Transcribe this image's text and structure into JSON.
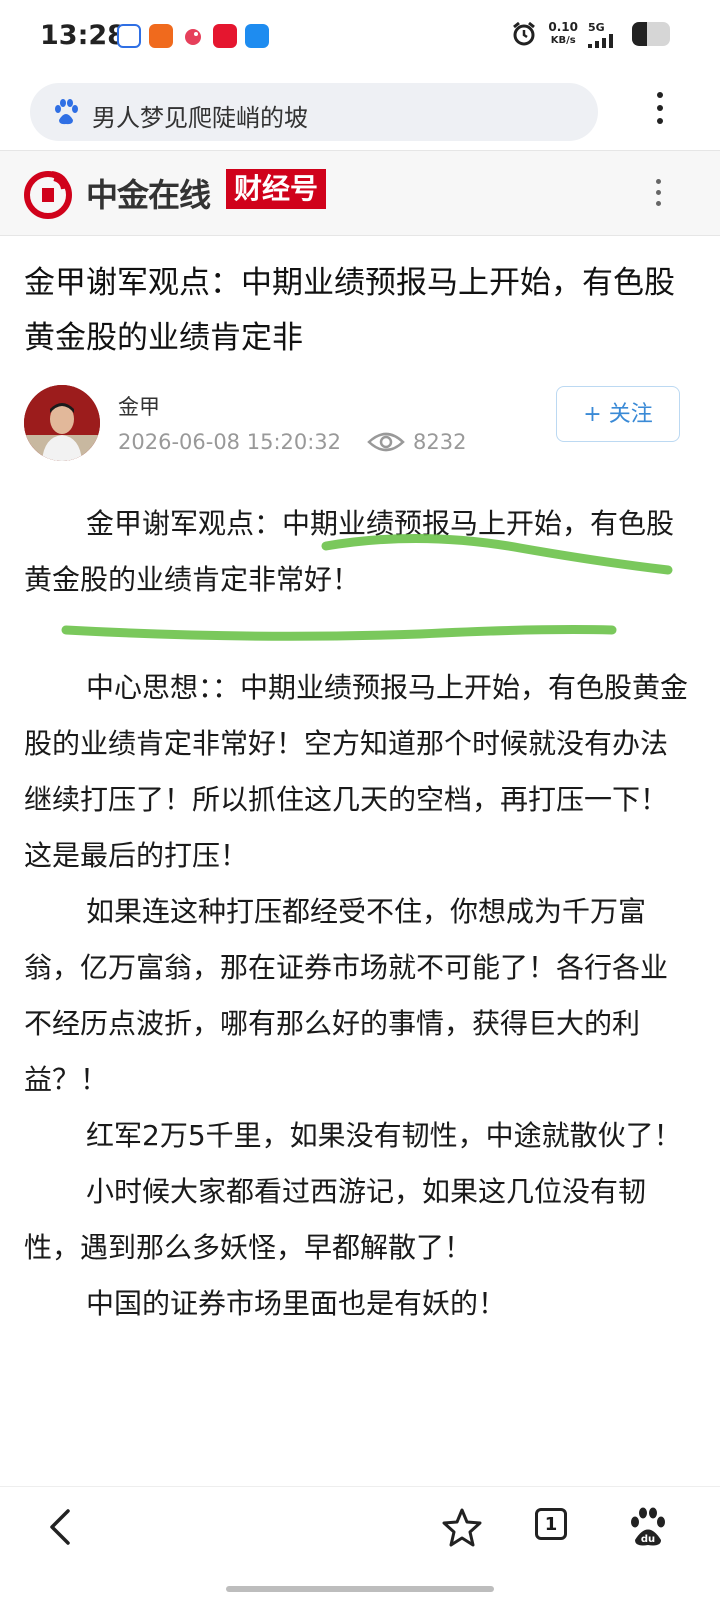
{
  "status_bar": {
    "time": "13:28",
    "net_speed_value": "0.10",
    "net_speed_unit": "KB/s",
    "network": "5G",
    "battery_level": 0.4
  },
  "search": {
    "query": "男人梦见爬陡峭的坡"
  },
  "publisher": {
    "name": "中金在线",
    "tag": "财经号"
  },
  "article": {
    "title": "金甲谢军观点：中期业绩预报马上开始，有色股黄金股的业绩肯定非",
    "author": "金甲",
    "datetime": "2026-06-08 15:20:32",
    "views": "8232",
    "follow_label": "+ 关注",
    "paragraphs": [
      "金甲谢军观点：中期业绩预报马上开始，有色股黄金股的业绩肯定非常好！",
      "中心思想：：中期业绩预报马上开始，有色股黄金股的业绩肯定非常好！空方知道那个时候就没有办法继续打压了！所以抓住这几天的空档，再打压一下！这是最后的打压！",
      "如果连这种打压都经受不住，你想成为千万富翁，亿万富翁，那在证券市场就不可能了！各行各业不经历点波折，哪有那么好的事情，获得巨大的利益？！",
      "红军2万5千里，如果没有韧性，中途就散伙了！",
      "小时候大家都看过西游记，如果这几位没有韧性，遇到那么多妖怪，早都解散了！",
      "中国的证券市场里面也是有妖的！"
    ]
  },
  "bottom_nav": {
    "tab_count": "1"
  },
  "colors": {
    "brand_red": "#d0021b",
    "follow_blue": "#3a8ad6",
    "highlight_green": "#6cc24a"
  }
}
